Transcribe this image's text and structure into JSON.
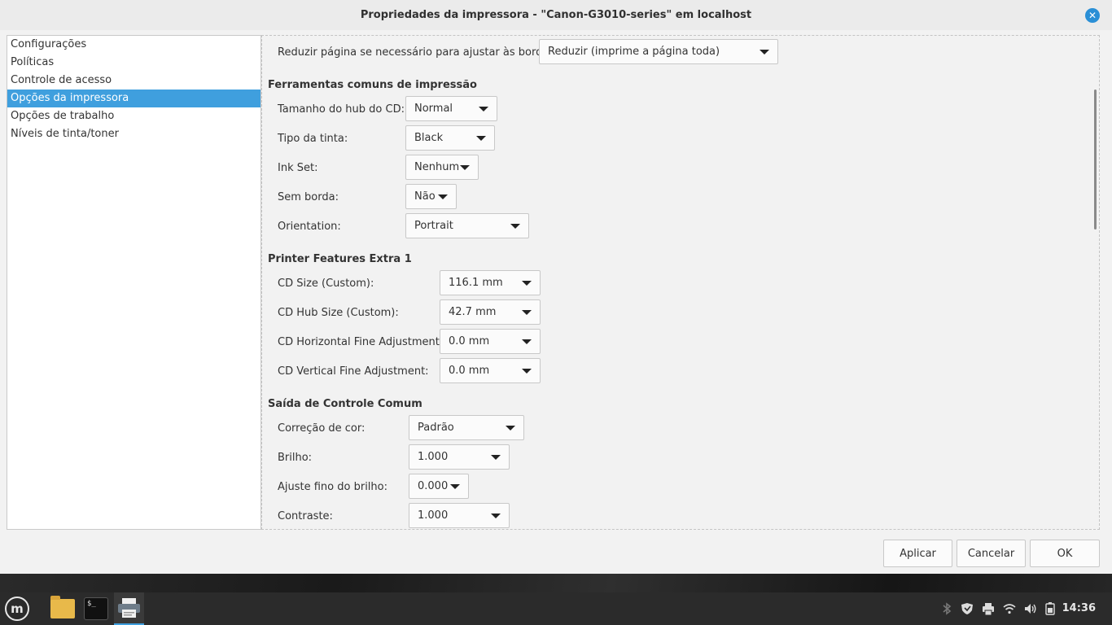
{
  "window": {
    "title": "Propriedades da impressora - \"Canon-G3010-series\" em localhost",
    "close_glyph": "✕"
  },
  "sidebar": {
    "items": [
      {
        "label": "Configurações"
      },
      {
        "label": "Políticas"
      },
      {
        "label": "Controle de acesso"
      },
      {
        "label": "Opções da impressora"
      },
      {
        "label": "Opções de trabalho"
      },
      {
        "label": "Níveis de tinta/toner"
      }
    ],
    "selected": "Opções da impressora"
  },
  "content": {
    "reduce_page": {
      "label": "Reduzir página se necessário para ajustar às bordas:",
      "value": "Reduzir (imprime a página toda)"
    },
    "section_common": "Ferramentas comuns de impressão",
    "cd_hub": {
      "label": "Tamanho do hub do CD:",
      "value": "Normal"
    },
    "ink_type": {
      "label": "Tipo da tinta:",
      "value": "Black"
    },
    "ink_set": {
      "label": "Ink Set:",
      "value": "Nenhum"
    },
    "borderless": {
      "label": "Sem borda:",
      "value": "Não"
    },
    "orientation": {
      "label": "Orientation:",
      "value": "Portrait"
    },
    "section_extra": "Printer Features Extra 1",
    "cd_size": {
      "label": "CD Size (Custom):",
      "value": "116.1 mm"
    },
    "cd_hub_size": {
      "label": "CD Hub Size (Custom):",
      "value": "42.7 mm"
    },
    "cd_h_adj": {
      "label": "CD Horizontal Fine Adjustment:",
      "value": "0.0 mm"
    },
    "cd_v_adj": {
      "label": "CD Vertical Fine Adjustment:",
      "value": "0.0 mm"
    },
    "section_output": "Saída de Controle Comum",
    "color_correction": {
      "label": "Correção de cor:",
      "value": "Padrão"
    },
    "brightness": {
      "label": "Brilho:",
      "value": "1.000"
    },
    "brightness_fine": {
      "label": "Ajuste fino do brilho:",
      "value": "0.000"
    },
    "contrast": {
      "label": "Contraste:",
      "value": "1.000"
    }
  },
  "buttons": {
    "apply": "Aplicar",
    "cancel": "Cancelar",
    "ok": "OK"
  },
  "taskbar": {
    "terminal_glyph": "$_",
    "mint_glyph": "m",
    "clock": "14:36"
  },
  "colors": {
    "accent": "#3f9fde",
    "close": "#2a8fd6"
  }
}
